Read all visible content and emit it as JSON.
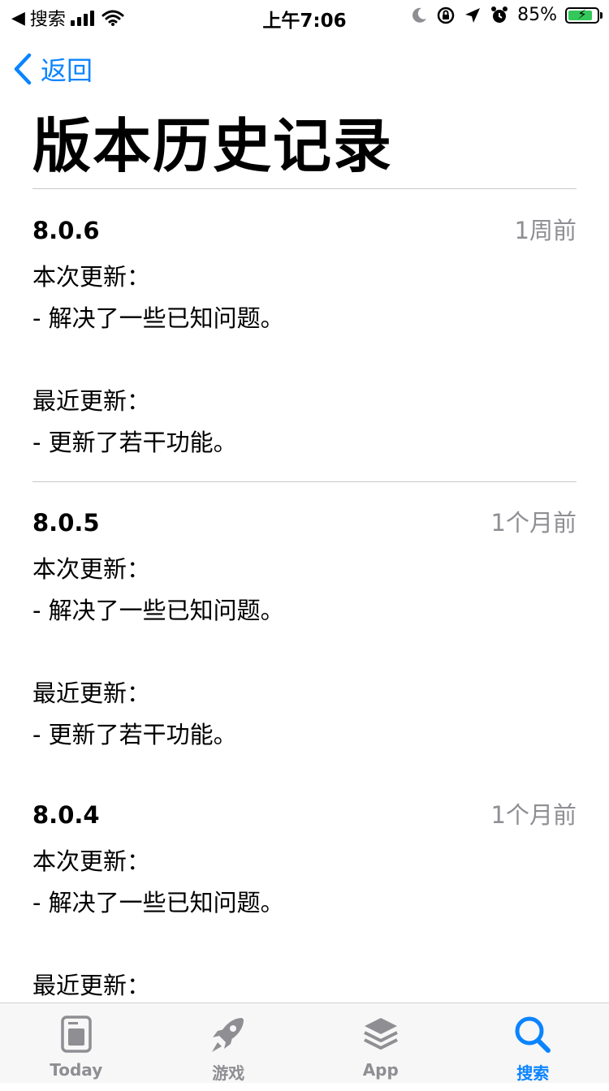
{
  "status_bar": {
    "back_label": "搜索",
    "time": "上午7:06",
    "battery": "85%",
    "battery_level": 0.85
  },
  "nav": {
    "back_label": "返回"
  },
  "page": {
    "title": "版本历史记录"
  },
  "versions": [
    {
      "version": "8.0.6",
      "date": "1周前",
      "notes": [
        "本次更新：",
        "- 解决了一些已知问题。",
        "",
        "最近更新：",
        "- 更新了若干功能。"
      ]
    },
    {
      "version": "8.0.5",
      "date": "1个月前",
      "notes": [
        "本次更新：",
        "- 解决了一些已知问题。",
        "",
        "最近更新：",
        "- 更新了若干功能。"
      ]
    },
    {
      "version": "8.0.4",
      "date": "1个月前",
      "notes": [
        "本次更新：",
        "- 解决了一些已知问题。",
        "",
        "最近更新："
      ]
    }
  ],
  "tab_bar": {
    "tabs": [
      {
        "label": "Today",
        "icon": "today-icon"
      },
      {
        "label": "游戏",
        "icon": "rocket-icon"
      },
      {
        "label": "App",
        "icon": "app-stack-icon"
      },
      {
        "label": "搜索",
        "icon": "search-icon"
      }
    ],
    "active_index": 3
  },
  "colors": {
    "accent": "#0a84ff",
    "secondary_text": "#8e8e93",
    "divider": "#c8c7cc"
  }
}
